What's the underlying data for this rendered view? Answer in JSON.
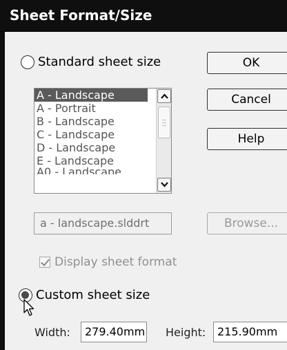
{
  "window": {
    "title": "Sheet Format/Size"
  },
  "standard": {
    "radio_label": "Standard sheet size",
    "list": [
      "A - Landscape",
      "A - Portrait",
      "B - Landscape",
      "C - Landscape",
      "D - Landscape",
      "E - Landscape",
      "A0 - Landscape"
    ],
    "selected_index": 0,
    "format_file": "a - landscape.slddrt",
    "display_format_label": "Display sheet format",
    "display_format_checked": true
  },
  "buttons": {
    "ok": "OK",
    "cancel": "Cancel",
    "help": "Help",
    "browse": "Browse..."
  },
  "custom": {
    "radio_label": "Custom sheet size",
    "width_label": "Width:",
    "width_value": "279.40mm",
    "height_label": "Height:",
    "height_value": "215.90mm"
  },
  "icons": {
    "scroll_up": "chevron-up-icon",
    "scroll_down": "chevron-down-icon",
    "cursor": "mouse-pointer-icon",
    "check": "checkmark-icon"
  }
}
